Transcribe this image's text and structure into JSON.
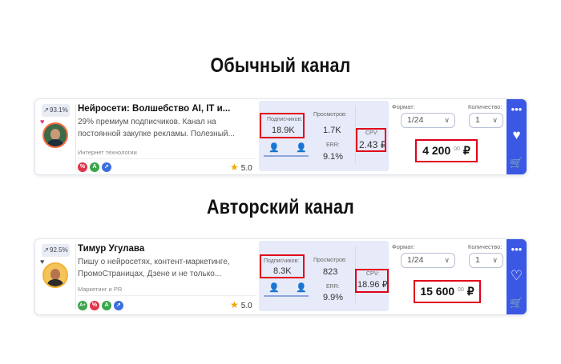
{
  "sections": {
    "regular_title": "Обычный канал",
    "author_title": "Авторский канал"
  },
  "cards": [
    {
      "rate": "93.1%",
      "title": "Нейросети: Волшебство AI, IT и...",
      "description": "29% премиум подписчиков. Канал на постоянной закупке рекламы. Полезный...",
      "category": "Интернет технологии",
      "rating": "5.0",
      "subscribers_label": "Подписчиков:",
      "subscribers": "18.9K",
      "views_label": "Просмотров:",
      "views": "1.7K",
      "err_label": "ERR:",
      "err": "9.1%",
      "cpv_label": "CPV:",
      "cpv": "2.43 ₽",
      "format_label": "Формат:",
      "format_value": "1/24",
      "quantity_label": "Количество:",
      "quantity_value": "1",
      "price_main": "4 200",
      "price_cents": "00",
      "currency": "₽",
      "tags": [
        {
          "text": "%",
          "color": "#e0344a"
        },
        {
          "text": "A",
          "color": "#3aa54a"
        },
        {
          "text": "➚",
          "color": "#3b6fe0"
        }
      ]
    },
    {
      "rate": "92.5%",
      "title": "Тимур Угулава",
      "description": "Пишу о нейросетях, контент-маркетинге, ПромоСтраницах, Дзене и не только...",
      "category": "Маркетинг и PR",
      "rating": "5.0",
      "subscribers_label": "Подписчиков:",
      "subscribers": "8.3K",
      "views_label": "Просмотров:",
      "views": "823",
      "err_label": "ERR:",
      "err": "9.9%",
      "cpv_label": "CPV:",
      "cpv": "18.96 ₽",
      "format_label": "Формат:",
      "format_value": "1/24",
      "quantity_label": "Количество:",
      "quantity_value": "1",
      "price_main": "15 600",
      "price_cents": "00",
      "currency": "₽",
      "tags": [
        {
          "text": "A+",
          "color": "#3aa54a"
        },
        {
          "text": "%",
          "color": "#e0344a"
        },
        {
          "text": "A",
          "color": "#3aa54a"
        },
        {
          "text": "➚",
          "color": "#3b6fe0"
        }
      ]
    }
  ],
  "icons": {
    "more": "more-icon",
    "favorite": "heart-icon",
    "cart": "add-to-cart-icon",
    "rating": "star-icon",
    "male": "male-icon",
    "female": "female-icon"
  },
  "colors": {
    "accent": "#3b58e4",
    "highlight": "#e0001b",
    "stats_bg": "#e7ebf9"
  }
}
